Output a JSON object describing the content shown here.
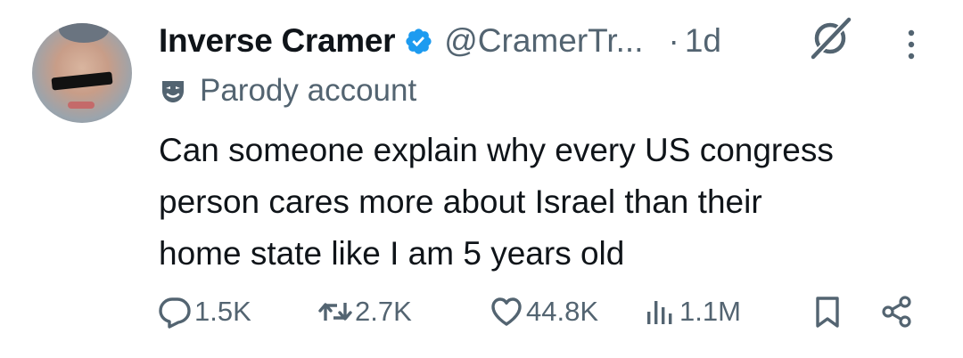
{
  "account": {
    "name": "Inverse Cramer",
    "handle": "@CramerTr...",
    "separator": "·",
    "time": "1d",
    "label": "Parody account"
  },
  "tweet": {
    "lines": [
      "Can someone explain why every US congress",
      "person cares more about Israel than their",
      "home state like I am 5 years old"
    ]
  },
  "actions": {
    "replies": "1.5K",
    "reposts": "2.7K",
    "likes": "44.8K",
    "views": "1.1M"
  },
  "colors": {
    "text": "#0f1419",
    "secondary": "#536471",
    "verified": "#1d9bf0"
  },
  "icons": [
    "grok-icon",
    "more-icon",
    "parody-mask-icon",
    "verified-badge-icon",
    "reply-icon",
    "repost-icon",
    "like-icon",
    "views-icon",
    "bookmark-icon",
    "share-icon"
  ]
}
